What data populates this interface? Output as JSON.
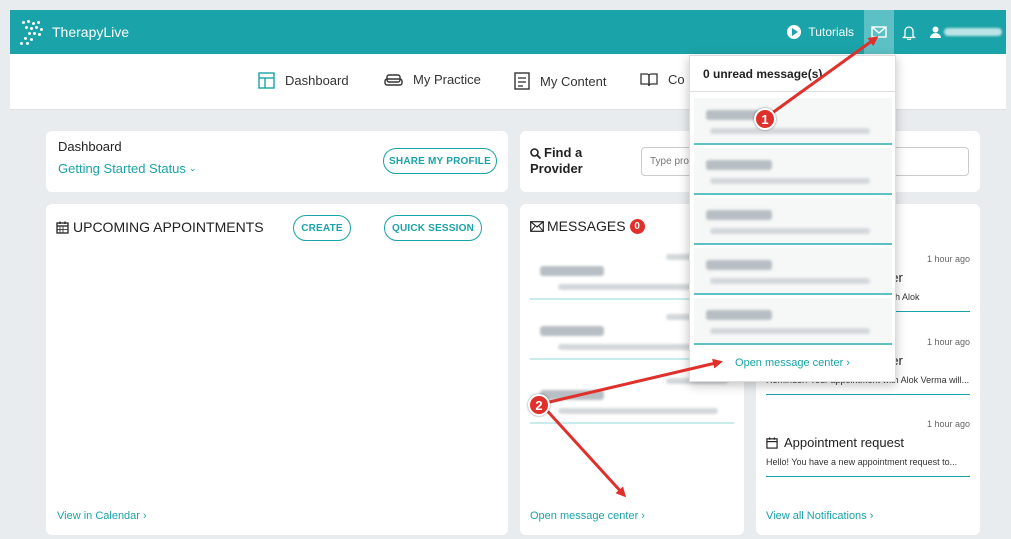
{
  "app": {
    "name": "TherapyLive"
  },
  "topbar": {
    "tutorials_label": "Tutorials",
    "mail_icon": "mail-icon",
    "bell_icon": "bell-icon",
    "user_icon": "user-icon"
  },
  "nav": {
    "items": [
      {
        "label": "Dashboard",
        "icon": "dashboard-icon"
      },
      {
        "label": "My Practice",
        "icon": "couch-icon"
      },
      {
        "label": "My Content",
        "icon": "content-icon"
      },
      {
        "label": "Co",
        "icon": "book-icon"
      }
    ]
  },
  "dashboard_card": {
    "title": "Dashboard",
    "status_label": "Getting Started Status",
    "share_button": "SHARE MY PROFILE"
  },
  "find_provider": {
    "title_line1": "Find a",
    "title_line2": "Provider",
    "search_placeholder": "Type pro"
  },
  "appointments": {
    "title": "UPCOMING APPOINTMENTS",
    "create_button": "CREATE",
    "quick_session_button": "QUICK SESSION",
    "calendar_link": "View in Calendar ›"
  },
  "messages": {
    "title": "MESSAGES",
    "unread_count": "0",
    "open_link": "Open message center ›"
  },
  "notifications": {
    "items": [
      {
        "ago": "1 hour ago",
        "title": "der",
        "body": "with Alok"
      },
      {
        "ago": "1 hour ago",
        "title": "der",
        "body": "Reminder: Your appointment with Alok Verma will..."
      },
      {
        "ago": "1 hour ago",
        "title": "Appointment request",
        "body": "Hello! You have a new appointment request to..."
      }
    ],
    "view_all_link": "View all Notifications ›"
  },
  "message_dropdown": {
    "header": "0 unread message(s)",
    "footer_link": "Open message center ›"
  },
  "annotations": {
    "step1": "1",
    "step2": "2",
    "arrow_color": "#e0302c"
  },
  "colors": {
    "brand": "#1aa3a8",
    "badge": "#e0302c",
    "background": "#e9ecef"
  }
}
